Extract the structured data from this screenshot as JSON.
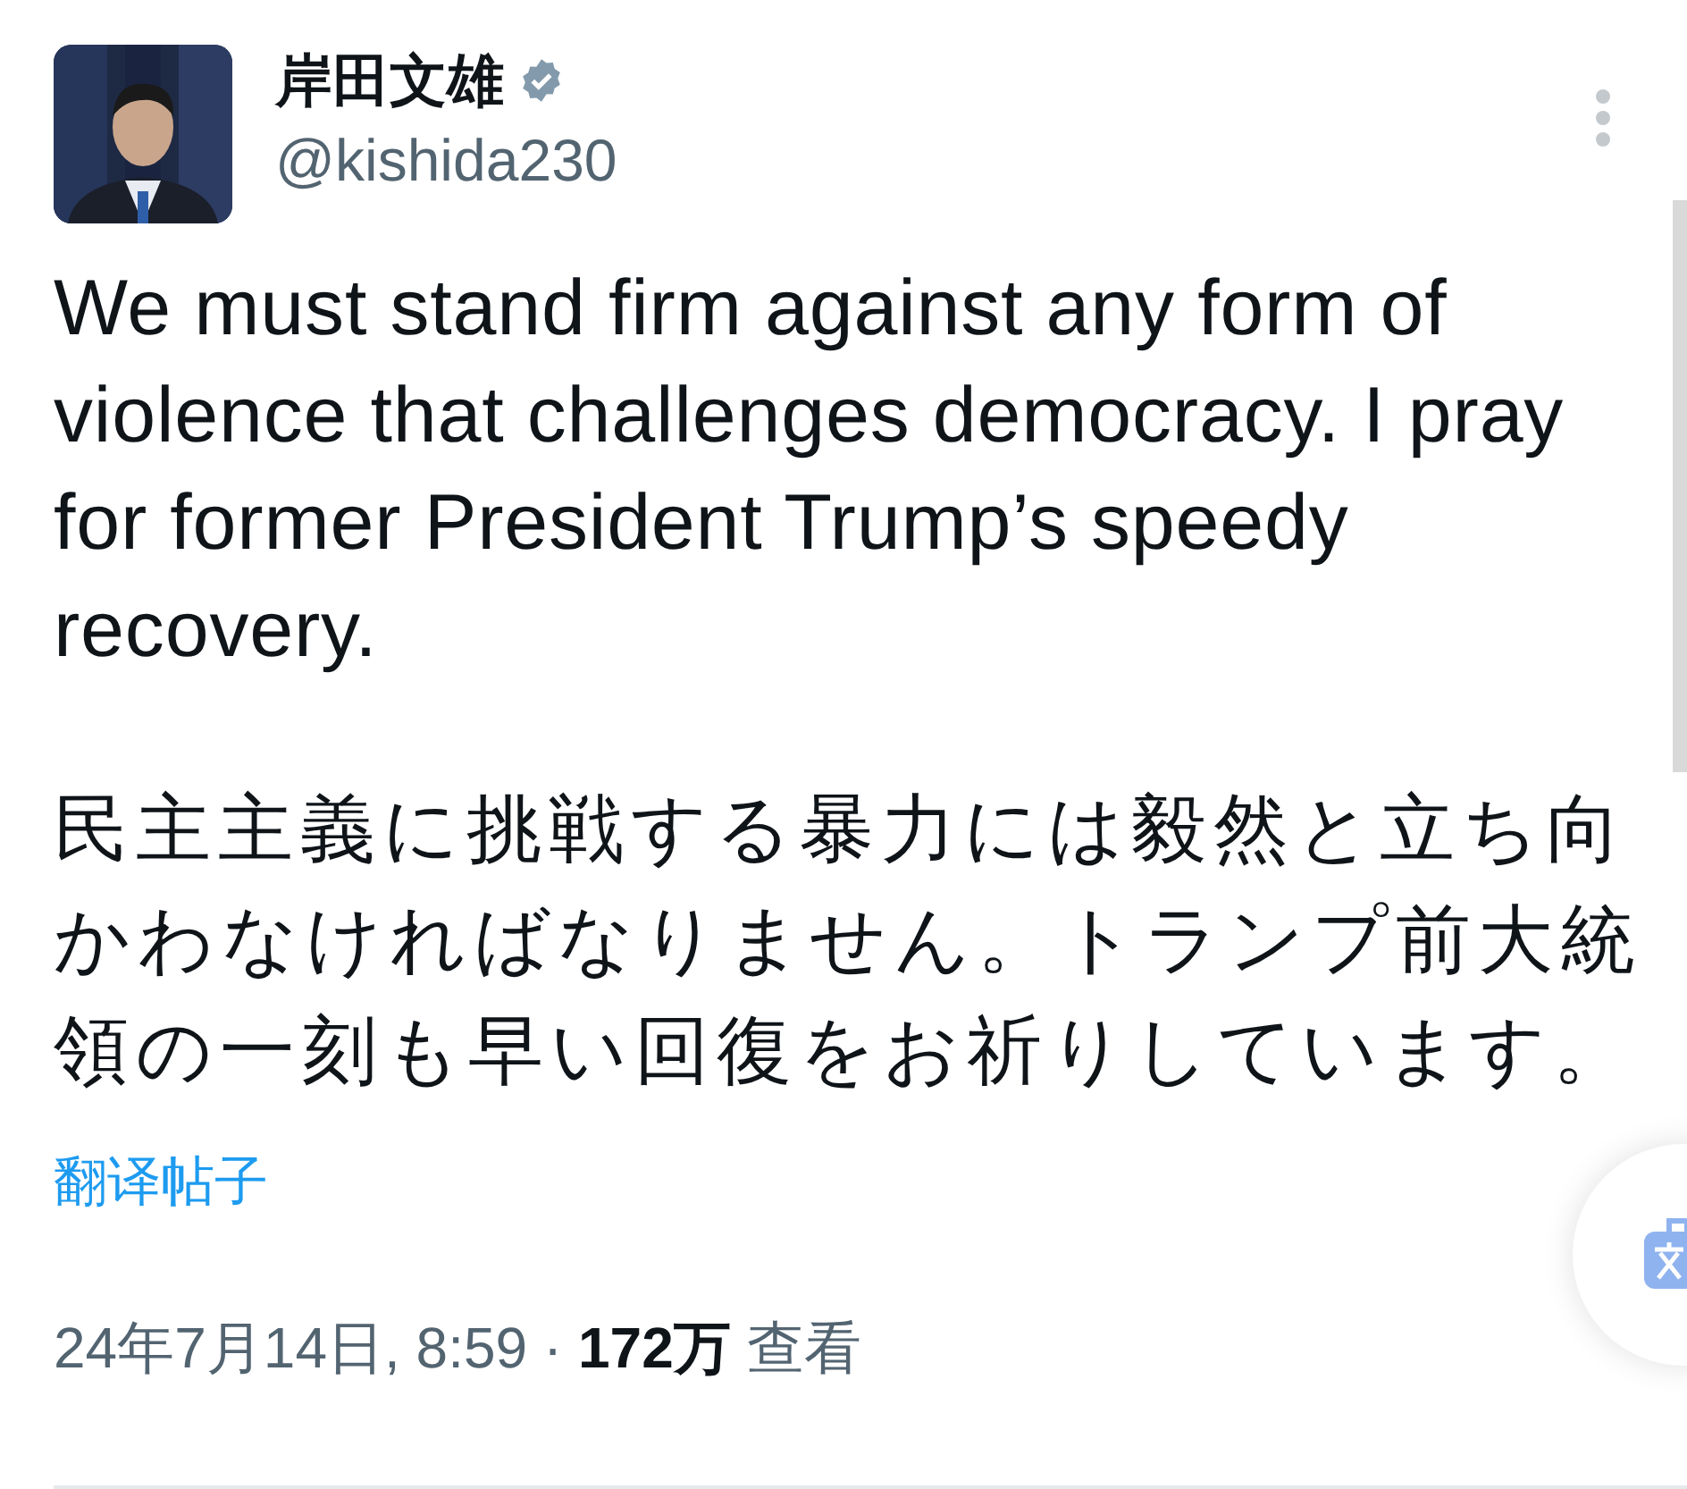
{
  "post": {
    "author": {
      "name": "岸田文雄",
      "verified": true,
      "handle": "@kishida230"
    },
    "text_en": "We must stand firm against any form of violence that challenges democracy. I pray for former President Trump’s speedy recovery.",
    "text_ja": "民主主義に挑戦する暴力には毅然と立ち向かわなければなりません。トランプ前大統領の一刻も早い回復をお祈りしています。",
    "translate_link": "翻译帖子",
    "timestamp": "24年7月14日, 8:59",
    "separator": "·",
    "views_count": "172万",
    "views_label": "查看"
  }
}
